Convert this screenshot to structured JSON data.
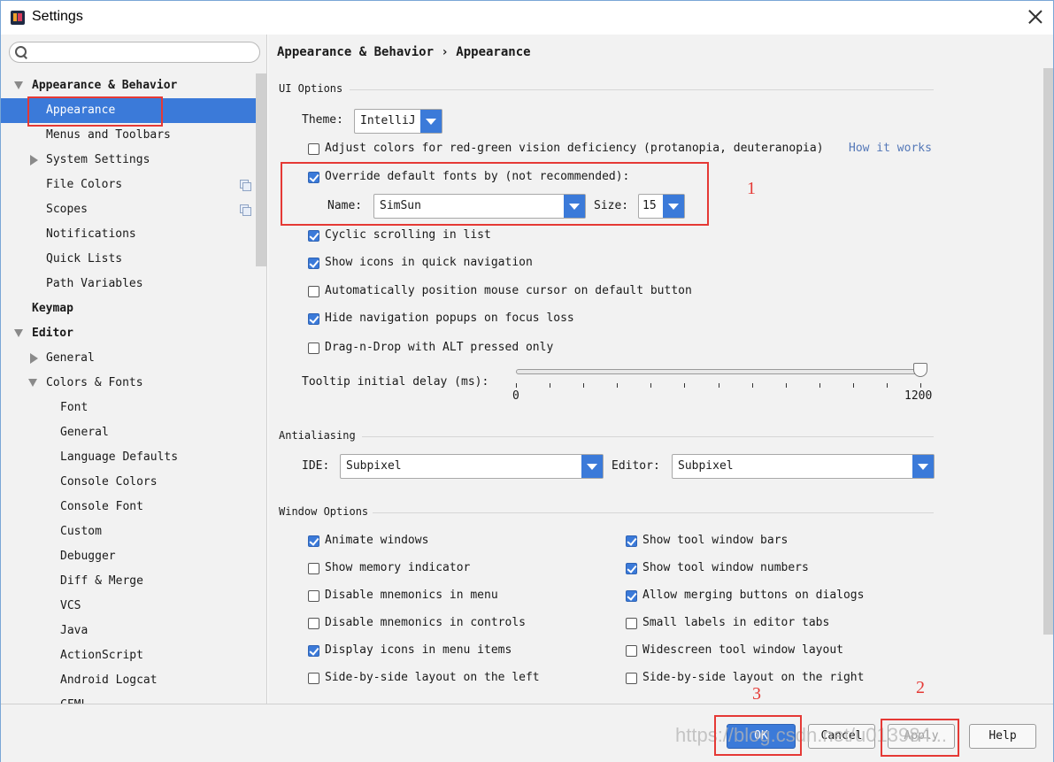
{
  "window": {
    "title": "Settings"
  },
  "sidebar": {
    "search_placeholder": "",
    "items": [
      {
        "label": "Appearance & Behavior",
        "arrow": "down"
      },
      {
        "label": "Appearance"
      },
      {
        "label": "Menus and Toolbars"
      },
      {
        "label": "System Settings",
        "arrow": "right"
      },
      {
        "label": "File Colors"
      },
      {
        "label": "Scopes"
      },
      {
        "label": "Notifications"
      },
      {
        "label": "Quick Lists"
      },
      {
        "label": "Path Variables"
      },
      {
        "label": "Keymap"
      },
      {
        "label": "Editor",
        "arrow": "down"
      },
      {
        "label": "General",
        "arrow": "right"
      },
      {
        "label": "Colors & Fonts",
        "arrow": "down"
      },
      {
        "label": "Font"
      },
      {
        "label": "General"
      },
      {
        "label": "Language Defaults"
      },
      {
        "label": "Console Colors"
      },
      {
        "label": "Console Font"
      },
      {
        "label": "Custom"
      },
      {
        "label": "Debugger"
      },
      {
        "label": "Diff & Merge"
      },
      {
        "label": "VCS"
      },
      {
        "label": "Java"
      },
      {
        "label": "ActionScript"
      },
      {
        "label": "Android Logcat"
      },
      {
        "label": "CFML"
      }
    ]
  },
  "content": {
    "breadcrumb": "Appearance & Behavior › Appearance",
    "ui_options": {
      "title": "UI Options",
      "theme_label": "Theme:",
      "theme_value": "IntelliJ",
      "adjust_colors": {
        "label": "Adjust colors for red-green vision deficiency (protanopia, deuteranopia)",
        "checked": false
      },
      "how_it_works": "How it works",
      "override_fonts": {
        "label": "Override default fonts by (not recommended):",
        "checked": true
      },
      "name_label": "Name:",
      "name_value": "SimSun",
      "size_label": "Size:",
      "size_value": "15",
      "cyclic_scrolling": {
        "label": "Cyclic scrolling in list",
        "checked": true
      },
      "show_icons_nav": {
        "label": "Show icons in quick navigation",
        "checked": true
      },
      "auto_position": {
        "label": "Automatically position mouse cursor on default button",
        "checked": false
      },
      "hide_nav_popups": {
        "label": "Hide navigation popups on focus loss",
        "checked": true
      },
      "drag_drop": {
        "label": "Drag-n-Drop with ALT pressed only",
        "checked": false
      },
      "tooltip_label": "Tooltip initial delay (ms):",
      "tooltip_min": "0",
      "tooltip_max": "1200",
      "tooltip_value": 1200
    },
    "antialiasing": {
      "title": "Antialiasing",
      "ide_label": "IDE:",
      "ide_value": "Subpixel",
      "editor_label": "Editor:",
      "editor_value": "Subpixel"
    },
    "window_options": {
      "title": "Window Options",
      "left": [
        {
          "label": "Animate windows",
          "checked": true
        },
        {
          "label": "Show memory indicator",
          "checked": false
        },
        {
          "label": "Disable mnemonics in menu",
          "checked": false
        },
        {
          "label": "Disable mnemonics in controls",
          "checked": false
        },
        {
          "label": "Display icons in menu items",
          "checked": true
        },
        {
          "label": "Side-by-side layout on the left",
          "checked": false
        }
      ],
      "right": [
        {
          "label": "Show tool window bars",
          "checked": true
        },
        {
          "label": "Show tool window numbers",
          "checked": true
        },
        {
          "label": "Allow merging buttons on dialogs",
          "checked": true
        },
        {
          "label": "Small labels in editor tabs",
          "checked": false
        },
        {
          "label": "Widescreen tool window layout",
          "checked": false
        },
        {
          "label": "Side-by-side layout on the right",
          "checked": false
        }
      ]
    }
  },
  "buttons": {
    "ok": "OK",
    "cancel": "Cancel",
    "apply": "Apply",
    "help": "Help"
  },
  "annotations": {
    "one": "1",
    "two": "2",
    "three": "3"
  },
  "watermark": "https://blog.csdn.net/u013984...",
  "colors": {
    "accent": "#3b7ad9",
    "annotation": "#e53935"
  }
}
